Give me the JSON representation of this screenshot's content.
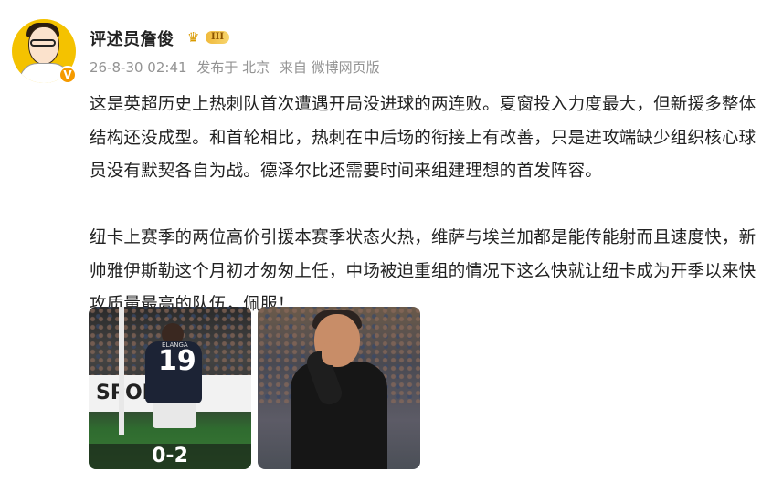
{
  "user": {
    "name": "评述员詹俊",
    "level": "III",
    "verified_mark": "V"
  },
  "post_meta": {
    "timestamp": "26-8-30 02:41",
    "location": "发布于 北京",
    "source": "来自 微博网页版"
  },
  "post": {
    "paragraph_1": "这是英超历史上热刺队首次遭遇开局没进球的两连败。夏窗投入力度最大，但新援多整体结构还没成型。和首轮相比，热刺在中后场的衔接上有改善，只是进攻端缺少组织核心球员没有默契各自为战。德泽尔比还需要时间来组建理想的首发阵容。",
    "paragraph_2": "纽卡上赛季的两位高价引援本赛季状态火热，维萨与埃兰加都是能传能射而且速度快，新帅雅伊斯勒这个月初才匆匆上任，中场被迫重组的情况下这么快就让纽卡成为开季以来快攻质量最高的队伍，佩服！"
  },
  "images": {
    "photo_1": {
      "ad_text": "SPORT",
      "player_name": "ELANGA",
      "player_number": "19",
      "score": "0-2"
    }
  },
  "icons": {
    "avatar": "cartoon-avatar",
    "verified": "verified-v-icon",
    "crown": "crown-icon"
  },
  "colors": {
    "meta_text": "#939393",
    "verified_orange": "#f59a00",
    "level_gold": "#f0b93a"
  }
}
